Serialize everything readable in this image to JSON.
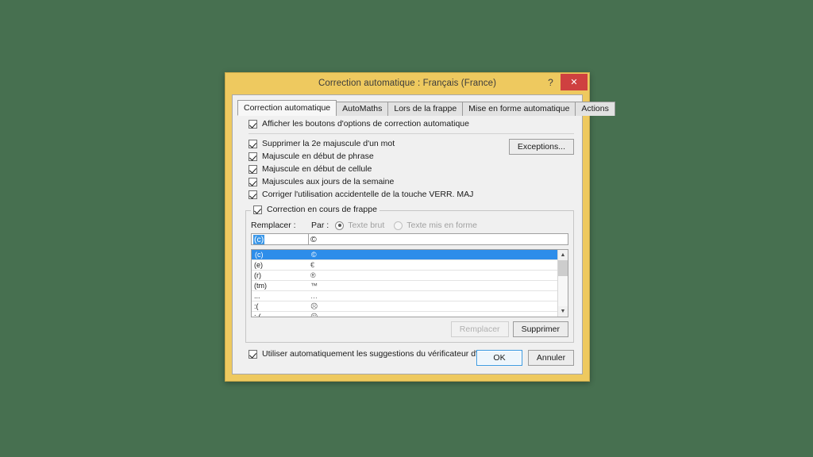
{
  "window": {
    "title": "Correction automatique : Français (France)",
    "help_label": "?",
    "close_label": "✕",
    "frame_color": "#eec95f",
    "desktop_color": "#477050",
    "close_button_color": "#cf4040"
  },
  "tabs": [
    {
      "label": "Correction automatique",
      "active": true
    },
    {
      "label": "AutoMaths",
      "active": false
    },
    {
      "label": "Lors de la frappe",
      "active": false
    },
    {
      "label": "Mise en forme automatique",
      "active": false
    },
    {
      "label": "Actions",
      "active": false
    }
  ],
  "options": {
    "show_buttons": {
      "label": "Afficher les boutons d'options de correction automatique",
      "checked": true
    },
    "items": [
      {
        "label": "Supprimer la 2e majuscule d'un mot",
        "checked": true
      },
      {
        "label": "Majuscule en début de phrase",
        "checked": true
      },
      {
        "label": "Majuscule en début de cellule",
        "checked": true
      },
      {
        "label": "Majuscules aux jours de la semaine",
        "checked": true
      },
      {
        "label": "Corriger l'utilisation accidentelle de la touche VERR. MAJ",
        "checked": true
      }
    ],
    "exceptions_button": "Exceptions..."
  },
  "replace_group": {
    "title": "Correction en cours de frappe",
    "checked": true,
    "replace_label": "Remplacer :",
    "with_label": "Par :",
    "radio_plain": {
      "label": "Texte brut",
      "selected": true,
      "disabled": false
    },
    "radio_formatted": {
      "label": "Texte mis en forme",
      "selected": false,
      "disabled": true
    },
    "replace_value": "(c)",
    "with_value": "©",
    "list_rows": [
      {
        "replace": "(c)",
        "with": "©",
        "selected": true
      },
      {
        "replace": "(e)",
        "with": "€",
        "selected": false
      },
      {
        "replace": "(r)",
        "with": "®",
        "selected": false
      },
      {
        "replace": "(tm)",
        "with": "™",
        "selected": false
      },
      {
        "replace": "...",
        "with": "…",
        "selected": false
      },
      {
        "replace": ":(",
        "with": "☹",
        "selected": false
      },
      {
        "replace": ":-(",
        "with": "☹",
        "selected": false
      }
    ],
    "replace_button": {
      "label": "Remplacer",
      "disabled": true
    },
    "delete_button": {
      "label": "Supprimer",
      "disabled": false
    }
  },
  "spellcheck": {
    "label": "Utiliser automatiquement les suggestions du vérificateur d'orthographe",
    "checked": true
  },
  "footer": {
    "ok_label": "OK",
    "cancel_label": "Annuler"
  }
}
